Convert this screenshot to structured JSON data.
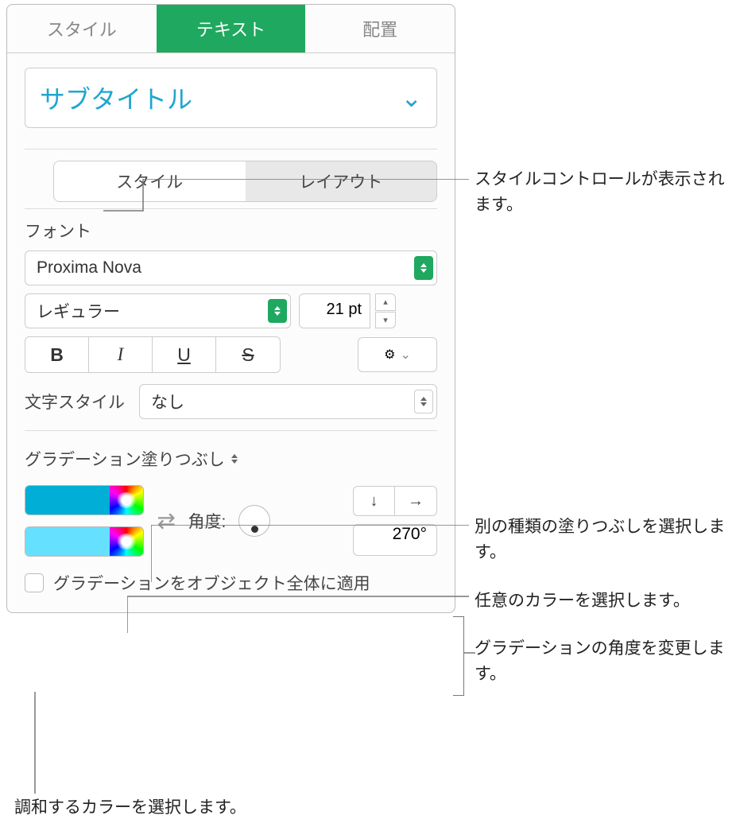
{
  "tabs": {
    "style": "スタイル",
    "text": "テキスト",
    "arrange": "配置"
  },
  "paragraphStyle": "サブタイトル",
  "subtabs": {
    "style": "スタイル",
    "layout": "レイアウト"
  },
  "font": {
    "label": "フォント",
    "family": "Proxima Nova",
    "weight": "レギュラー",
    "size": "21 pt",
    "bold": "B",
    "italic": "I",
    "underline": "U",
    "strike": "S"
  },
  "charStyle": {
    "label": "文字スタイル",
    "value": "なし"
  },
  "fill": {
    "menu": "グラデーション塗りつぶし",
    "angleLabel": "角度:",
    "angleValue": "270°",
    "colors": [
      "#00aed6",
      "#66e0ff"
    ],
    "checkbox": "グラデーションをオブジェクト全体に適用"
  },
  "callouts": {
    "c1": "スタイルコントロールが表示されます。",
    "c2": "別の種類の塗りつぶしを選択します。",
    "c3": "任意のカラーを選択します。",
    "c4": "グラデーションの角度を変更します。",
    "c5": "調和するカラーを選択します。"
  }
}
